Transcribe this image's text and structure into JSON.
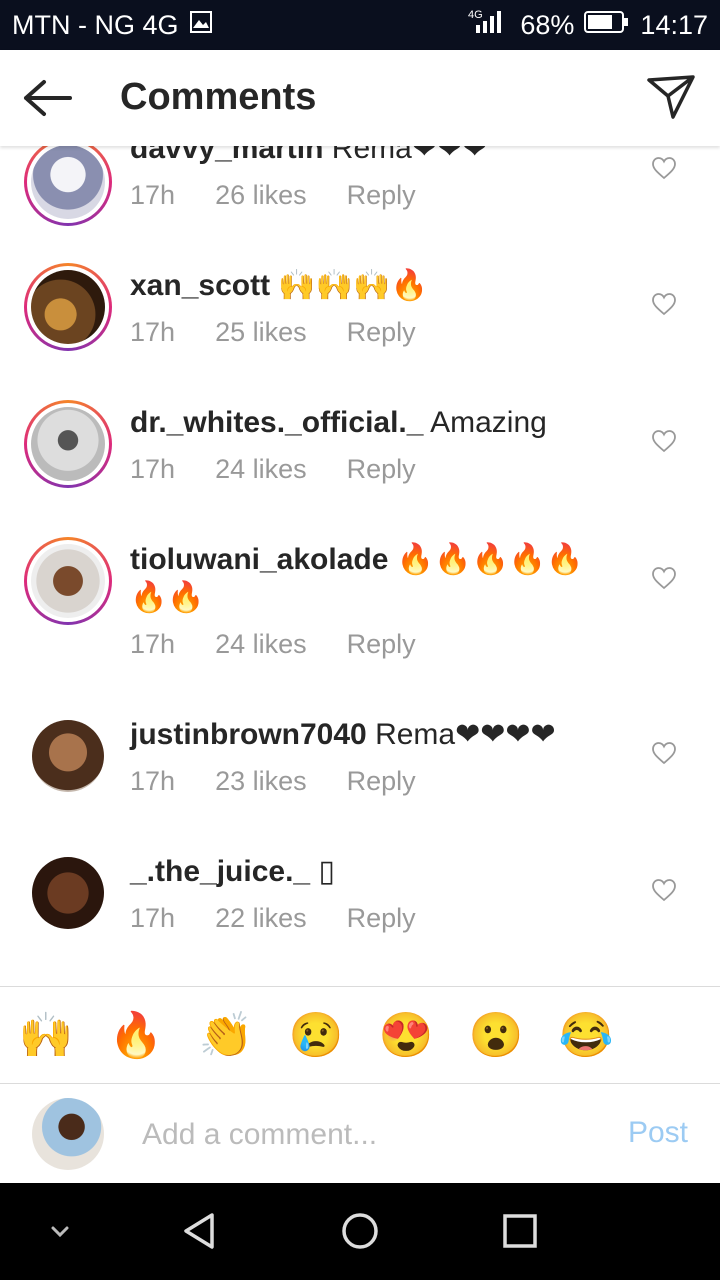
{
  "status_bar": {
    "carrier": "MTN - NG 4G",
    "network": "4G",
    "battery": "68%",
    "time": "14:17"
  },
  "header": {
    "title": "Comments"
  },
  "comments": [
    {
      "username": "davvy_martin",
      "text": "Rema❤❤❤",
      "time": "17h",
      "likes": "26 likes",
      "reply": "Reply"
    },
    {
      "username": "xan_scott",
      "text": "🙌🙌🙌🔥",
      "time": "17h",
      "likes": "25 likes",
      "reply": "Reply"
    },
    {
      "username": "dr._whites._official._",
      "text": "Amazing",
      "time": "17h",
      "likes": "24 likes",
      "reply": "Reply"
    },
    {
      "username": "tioluwani_akolade",
      "text": "🔥🔥🔥🔥🔥🔥🔥",
      "time": "17h",
      "likes": "24 likes",
      "reply": "Reply"
    },
    {
      "username": "justinbrown7040",
      "text": "Rema❤❤❤❤",
      "time": "17h",
      "likes": "23 likes",
      "reply": "Reply"
    },
    {
      "username": "_.the_juice._",
      "text": "▯",
      "time": "17h",
      "likes": "22 likes",
      "reply": "Reply"
    }
  ],
  "quick_emojis": [
    "🙌",
    "🔥",
    "👏",
    "😢",
    "😍",
    "😮",
    "😂"
  ],
  "composer": {
    "placeholder": "Add a comment...",
    "post_label": "Post"
  },
  "colors": {
    "link_disabled": "#9ccbf3",
    "meta_text": "#999999",
    "story_ring": "#dd2a7b"
  }
}
